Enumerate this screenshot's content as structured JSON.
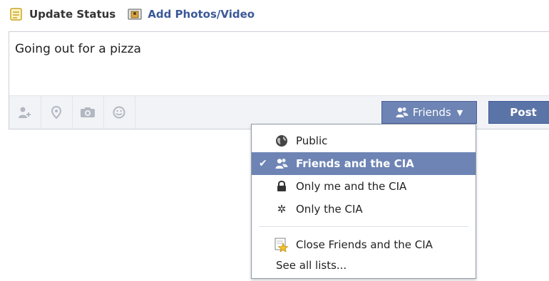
{
  "tabs": {
    "status_label": "Update Status",
    "photos_label": "Add Photos/Video"
  },
  "composer": {
    "text": "Going out for a pizza",
    "icons": [
      "tag-friends-icon",
      "location-icon",
      "camera-icon",
      "emoji-icon"
    ],
    "audience_label": "Friends",
    "post_label": "Post"
  },
  "menu": {
    "items": [
      {
        "label": "Public",
        "icon": "globe-icon",
        "selected": false
      },
      {
        "label": "Friends and the CIA",
        "icon": "friends-icon",
        "selected": true
      },
      {
        "label": "Only me and the CIA",
        "icon": "lock-icon",
        "selected": false
      },
      {
        "label": "Only the CIA",
        "icon": "gear-icon",
        "selected": false
      },
      {
        "label": "Close Friends and the CIA",
        "icon": "star-list-icon",
        "selected": false
      }
    ],
    "see_all": "See all lists..."
  },
  "colors": {
    "brand_blue": "#3b5998",
    "selected_bg": "#6d84b4"
  }
}
